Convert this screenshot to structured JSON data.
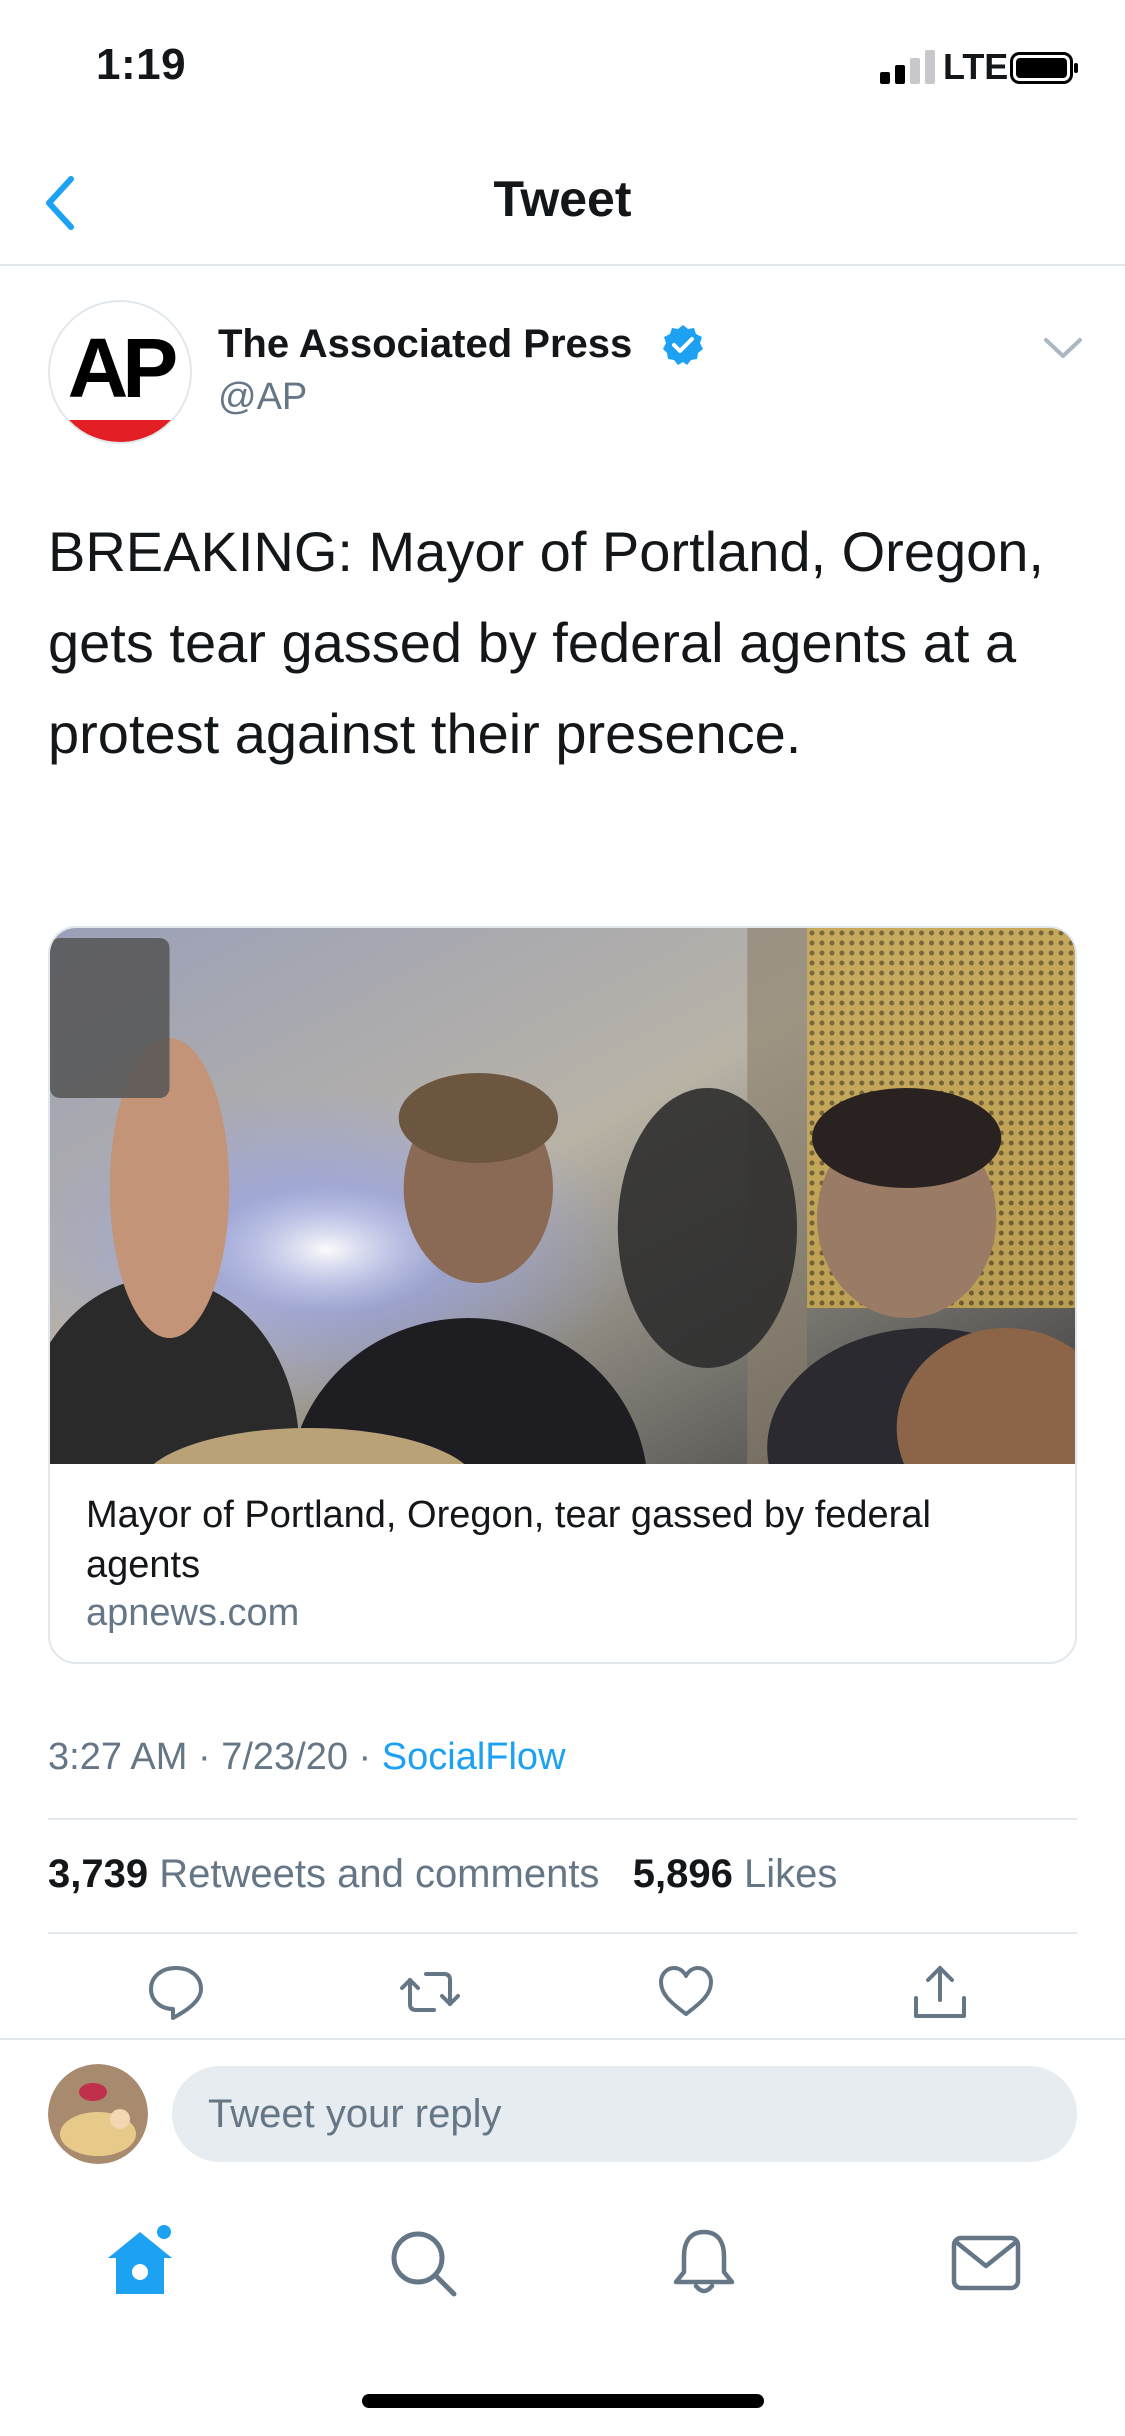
{
  "status_bar": {
    "time": "1:19",
    "network": "LTE"
  },
  "nav": {
    "title": "Tweet"
  },
  "author": {
    "name": "The Associated Press",
    "handle": "@AP",
    "avatar_text": "AP"
  },
  "tweet": {
    "text": "BREAKING: Mayor of Portland, Oregon, gets tear gassed by federal agents at a protest against their presence."
  },
  "card": {
    "title": "Mayor of Portland, Oregon, tear gassed by federal agents",
    "domain": "apnews.com"
  },
  "meta": {
    "time": "3:27 AM",
    "separator": " · ",
    "date": "7/23/20",
    "source": "SocialFlow"
  },
  "stats": {
    "retweets_count": "3,739",
    "retweets_label": "Retweets and comments",
    "likes_count": "5,896",
    "likes_label": "Likes"
  },
  "actions": [
    "comment-icon",
    "retweet-icon",
    "like-icon",
    "share-icon"
  ],
  "reply": {
    "placeholder": "Tweet your reply"
  },
  "tab_bar": [
    "home-icon",
    "search-icon",
    "notifications-icon",
    "messages-icon"
  ],
  "colors": {
    "accent": "#1da1f2",
    "muted": "#657786",
    "divider": "#e1e8ed",
    "ap_red": "#e31e24"
  }
}
